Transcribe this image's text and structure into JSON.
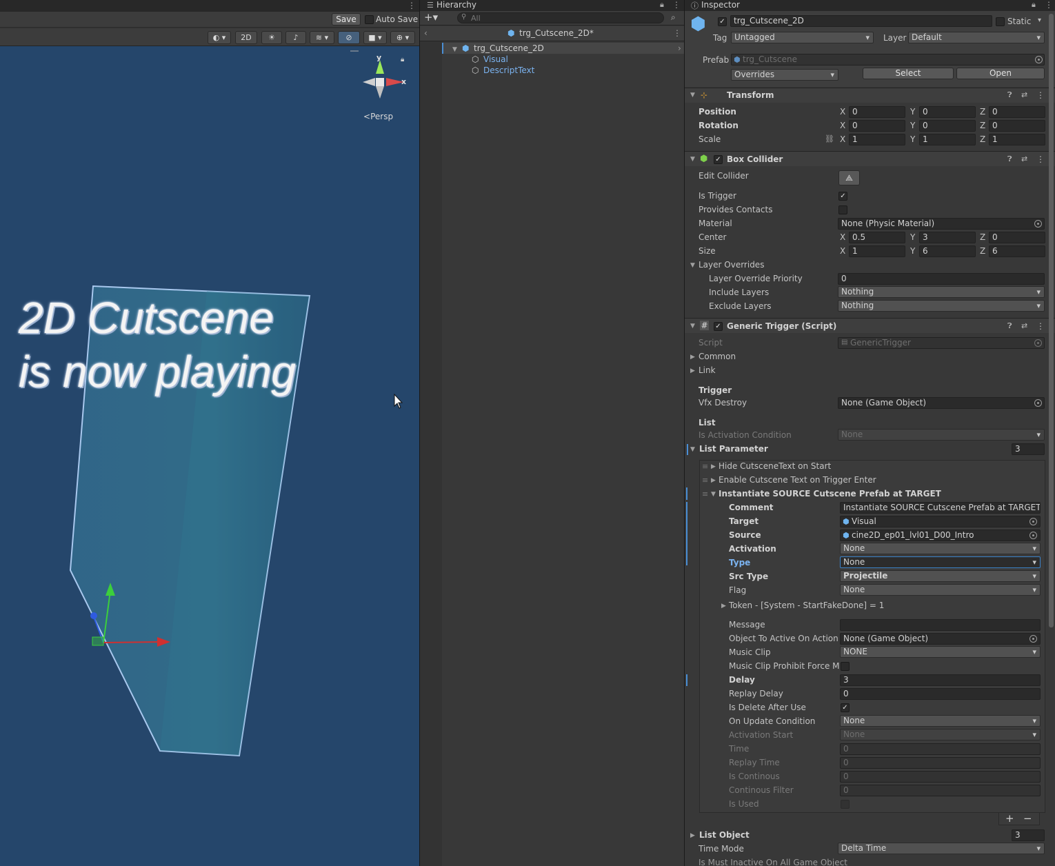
{
  "scene": {
    "save_label": "Save",
    "autosave_label": "Auto Save",
    "mode_2d_label": "2D",
    "persp_label": "Persp",
    "axis_y": "y",
    "axis_x": "x",
    "overlay_line1": "2D Cutscene",
    "overlay_line2": "is now playing"
  },
  "hierarchy": {
    "tab_label": "Hierarchy",
    "search_placeholder": "All",
    "breadcrumb": "trg_Cutscene_2D*",
    "items": [
      {
        "label": "trg_Cutscene_2D"
      },
      {
        "label": "Visual"
      },
      {
        "label": "DescriptText"
      }
    ]
  },
  "inspector": {
    "tab_label": "Inspector",
    "object_name": "trg_Cutscene_2D",
    "static_label": "Static",
    "tag_label": "Tag",
    "tag_value": "Untagged",
    "layer_label": "Layer",
    "layer_value": "Default",
    "prefab_label": "Prefab",
    "prefab_value": "trg_Cutscene",
    "overrides_label": "Overrides",
    "select_label": "Select",
    "open_label": "Open",
    "transform": {
      "title": "Transform",
      "position_label": "Position",
      "rotation_label": "Rotation",
      "scale_label": "Scale",
      "position": [
        "0",
        "0",
        "0"
      ],
      "rotation": [
        "0",
        "0",
        "0"
      ],
      "scale": [
        "1",
        "1",
        "1"
      ]
    },
    "box_collider": {
      "title": "Box Collider",
      "edit_collider_label": "Edit Collider",
      "is_trigger_label": "Is Trigger",
      "provides_contacts_label": "Provides Contacts",
      "material_label": "Material",
      "material_value": "None (Physic Material)",
      "center_label": "Center",
      "center": [
        "0.5",
        "3",
        "0"
      ],
      "size_label": "Size",
      "size": [
        "1",
        "6",
        "6"
      ],
      "layer_overrides_label": "Layer Overrides",
      "priority_label": "Layer Override Priority",
      "priority_value": "0",
      "include_label": "Include Layers",
      "include_value": "Nothing",
      "exclude_label": "Exclude Layers",
      "exclude_value": "Nothing"
    },
    "generic_trigger": {
      "title": "Generic Trigger (Script)",
      "script_label": "Script",
      "script_value": "GenericTrigger",
      "common_label": "Common",
      "link_label": "Link",
      "trigger_header": "Trigger",
      "vfx_label": "Vfx Destroy",
      "vfx_value": "None (Game Object)",
      "list_header": "List",
      "activation_cond_label": "Is Activation Condition",
      "activation_cond_value": "None",
      "list_param_label": "List Parameter",
      "list_param_count": "3",
      "elements": [
        {
          "label": "Hide CutsceneText on Start"
        },
        {
          "label": "Enable Cutscene Text on Trigger Enter"
        },
        {
          "label": "Instantiate SOURCE Cutscene Prefab at TARGET"
        }
      ],
      "element": {
        "comment_label": "Comment",
        "comment_value": "Instantiate SOURCE Cutscene Prefab at TARGET",
        "target_label": "Target",
        "target_value": "Visual",
        "source_label": "Source",
        "source_value": "cine2D_ep01_lvl01_D00_Intro",
        "activation_label": "Activation",
        "activation_value": "None",
        "type_label": "Type",
        "type_value": "None",
        "src_type_label": "Src Type",
        "src_type_value": "Projectile",
        "flag_label": "Flag",
        "flag_value": "None",
        "token_label": "Token - [System - StartFakeDone] = 1",
        "message_label": "Message",
        "message_value": "",
        "obj_active_label": "Object To Active On Action E",
        "obj_active_value": "None (Game Object)",
        "music_clip_label": "Music Clip",
        "music_clip_value": "NONE",
        "music_prohibit_label": "Music Clip Prohibit Force Mu",
        "delay_label": "Delay",
        "delay_value": "3",
        "replay_delay_label": "Replay Delay",
        "replay_delay_value": "0",
        "delete_after_label": "Is Delete After Use",
        "on_update_label": "On Update Condition",
        "on_update_value": "None",
        "activation_start_label": "Activation Start",
        "activation_start_value": "None",
        "time_label": "Time",
        "time_value": "0",
        "replay_time_label": "Replay Time",
        "replay_time_value": "0",
        "is_continous_label": "Is Continous",
        "is_continous_value": "0",
        "continous_filter_label": "Continous Filter",
        "continous_filter_value": "0",
        "is_used_label": "Is Used"
      },
      "plus_label": "+",
      "minus_label": "−",
      "list_object_label": "List Object",
      "list_object_count": "3",
      "time_mode_label": "Time Mode",
      "time_mode_value": "Delta Time",
      "cut_label": "Is Must Inactive On All Game Object"
    }
  },
  "colors": {
    "viewport_bg": "#25466b",
    "selection_blue": "#4a8fd6",
    "axis_red": "#d03030",
    "axis_green": "#3ccf3c",
    "axis_blue": "#2f5be0"
  }
}
